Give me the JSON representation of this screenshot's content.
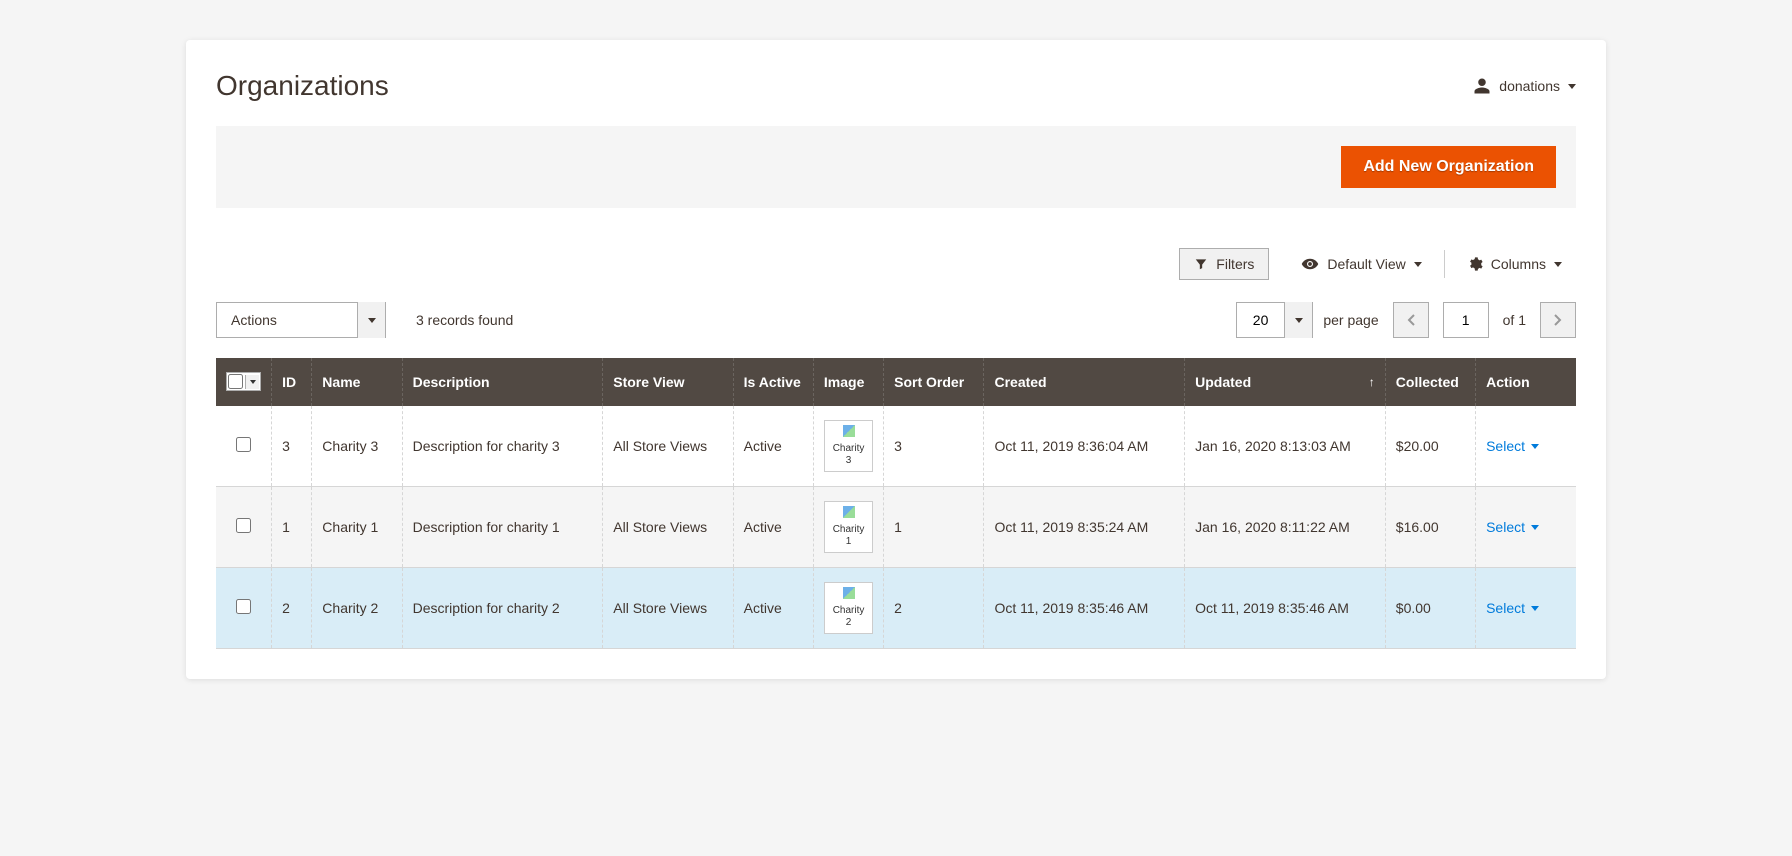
{
  "page_title": "Organizations",
  "user_menu": {
    "label": "donations"
  },
  "buttons": {
    "add_new": "Add New Organization",
    "filters": "Filters",
    "default_view": "Default View",
    "columns": "Columns"
  },
  "actions_select": {
    "label": "Actions"
  },
  "records_found": "3 records found",
  "pagination": {
    "page_size": "20",
    "per_page_label": "per page",
    "current_page": "1",
    "of_label": "of 1"
  },
  "columns_headers": {
    "id": "ID",
    "name": "Name",
    "description": "Description",
    "store_view": "Store View",
    "is_active": "Is Active",
    "image": "Image",
    "sort_order": "Sort Order",
    "created": "Created",
    "updated": "Updated",
    "collected": "Collected",
    "action": "Action"
  },
  "rows": [
    {
      "id": "3",
      "name": "Charity 3",
      "description": "Description for charity 3",
      "store_view": "All Store Views",
      "is_active": "Active",
      "image_alt": "Charity 3",
      "sort_order": "3",
      "created": "Oct 11, 2019 8:36:04 AM",
      "updated": "Jan 16, 2020 8:13:03 AM",
      "collected": "$20.00",
      "action": "Select"
    },
    {
      "id": "1",
      "name": "Charity 1",
      "description": "Description for charity 1",
      "store_view": "All Store Views",
      "is_active": "Active",
      "image_alt": "Charity 1",
      "sort_order": "1",
      "created": "Oct 11, 2019 8:35:24 AM",
      "updated": "Jan 16, 2020 8:11:22 AM",
      "collected": "$16.00",
      "action": "Select"
    },
    {
      "id": "2",
      "name": "Charity 2",
      "description": "Description for charity 2",
      "store_view": "All Store Views",
      "is_active": "Active",
      "image_alt": "Charity 2",
      "sort_order": "2",
      "created": "Oct 11, 2019 8:35:46 AM",
      "updated": "Oct 11, 2019 8:35:46 AM",
      "collected": "$0.00",
      "action": "Select"
    }
  ]
}
